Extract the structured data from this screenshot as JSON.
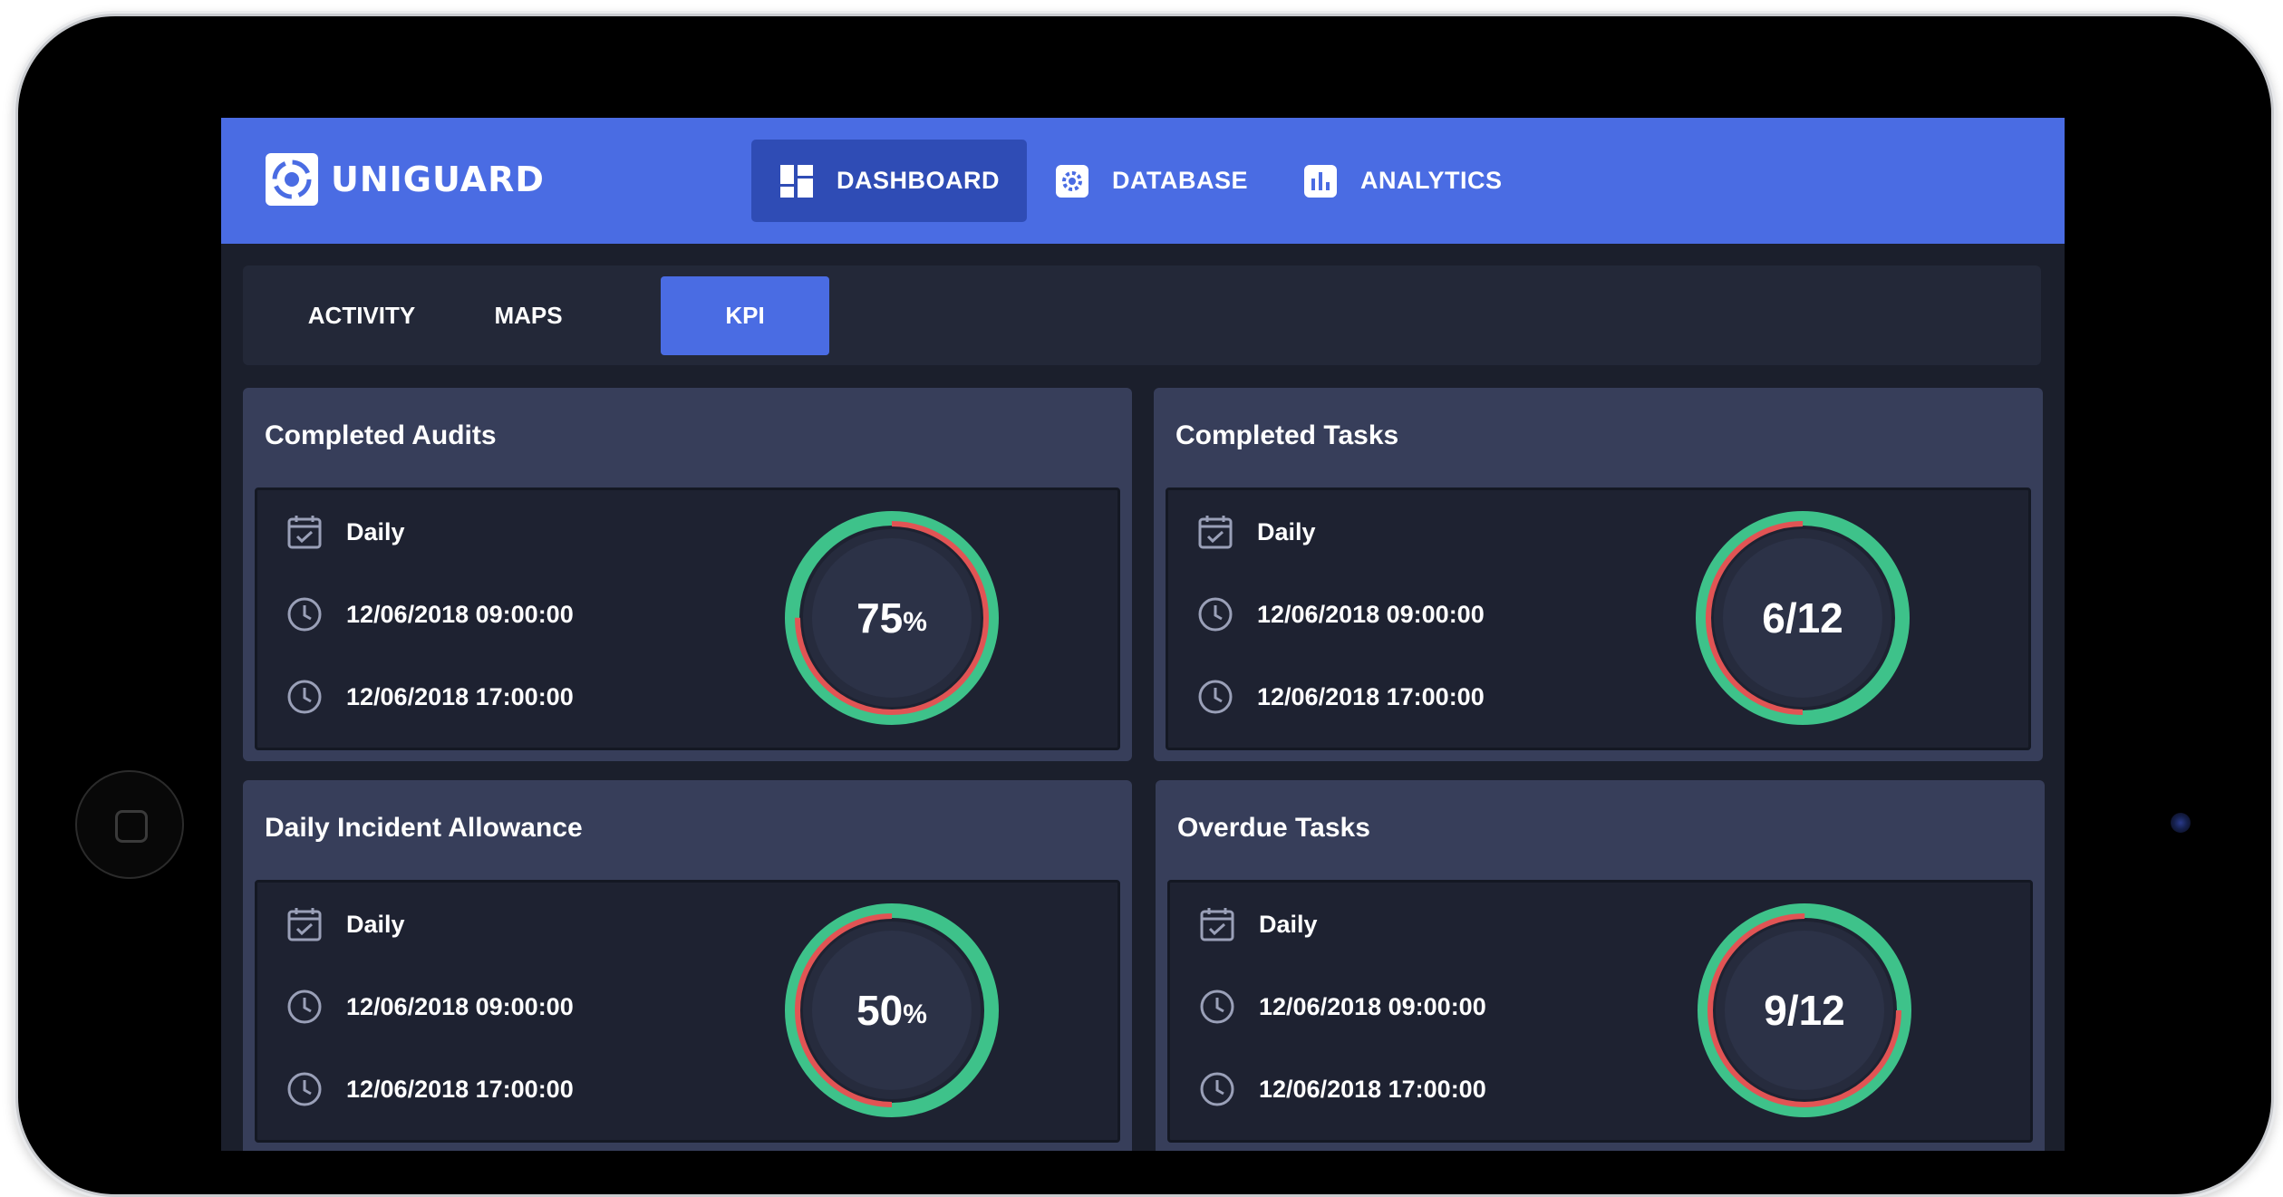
{
  "brand": {
    "name": "UNIGUARD"
  },
  "nav": [
    {
      "label": "DASHBOARD",
      "icon": "dashboard-icon",
      "active": true
    },
    {
      "label": "DATABASE",
      "icon": "gear-icon",
      "active": false
    },
    {
      "label": "ANALYTICS",
      "icon": "bar-chart-icon",
      "active": false
    }
  ],
  "tabs": [
    {
      "label": "ACTIVITY",
      "active": false
    },
    {
      "label": "MAPS",
      "active": false
    },
    {
      "label": "KPI",
      "active": true
    }
  ],
  "cards": [
    {
      "title": "Completed Audits",
      "period": "Daily",
      "start": "12/06/2018 09:00:00",
      "end": "12/06/2018 17:00:00",
      "value_main": "75",
      "value_suffix": "%",
      "fraction": 0.75
    },
    {
      "title": "Completed Tasks",
      "period": "Daily",
      "start": "12/06/2018 09:00:00",
      "end": "12/06/2018 17:00:00",
      "value_main": "6/12",
      "value_suffix": "",
      "fraction": 0.5
    },
    {
      "title": "Daily Incident Allowance",
      "period": "Daily",
      "start": "12/06/2018 09:00:00",
      "end": "12/06/2018 17:00:00",
      "value_main": "50",
      "value_suffix": "%",
      "fraction": 0.5
    },
    {
      "title": "Overdue Tasks",
      "period": "Daily",
      "start": "12/06/2018 09:00:00",
      "end": "12/06/2018 17:00:00",
      "value_main": "9/12",
      "value_suffix": "",
      "fraction": 0.75
    }
  ],
  "colors": {
    "primary": "#4a6ce3",
    "ring_outer": "#3ec28a",
    "ring_inner": "#e15454"
  }
}
